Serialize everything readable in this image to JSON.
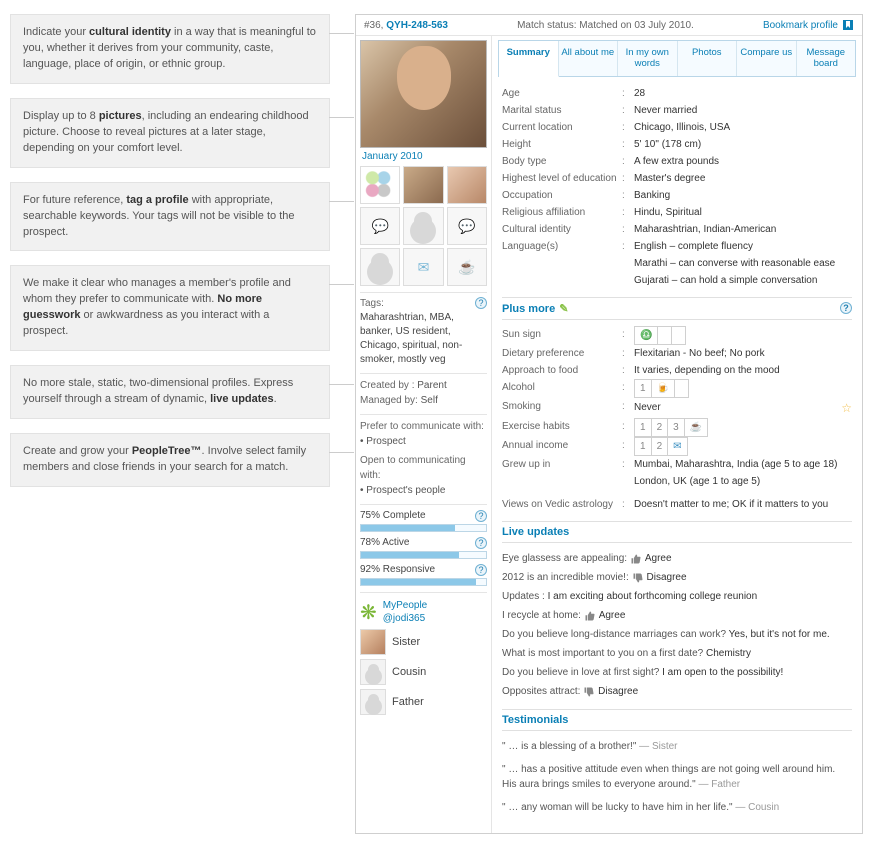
{
  "callouts": [
    "Indicate your <b>cultural identity</b> in a way that is meaningful to you, whether it derives from your community, caste, language, place of origin, or ethnic group.",
    "Display up to 8 <b>pictures</b>, including an endearing childhood picture.  Choose to reveal pictures at a later stage, depending on your comfort level.",
    "For future reference, <b>tag a profile</b> with appropriate, searchable keywords. Your tags will not be visible to the prospect.",
    "We make it clear who manages a member's profile and whom they prefer to communicate with. <b>No more guesswork</b> or awkwardness as you interact with a prospect.",
    "No more stale, static, two-dimensional profiles. Express yourself through a stream of dynamic, <b>live updates</b>.",
    "Create and grow your <b>PeopleTree™</b>. Involve select family members and close friends in your search for a match."
  ],
  "topbar": {
    "num": "#36,",
    "code": "QYH-248-563",
    "match_status": "Match status: Matched on 03 July 2010.",
    "bookmark": "Bookmark profile"
  },
  "photo_caption": "January 2010",
  "tags_label": "Tags:",
  "tags_text": "Maharashtrian, MBA, banker, US resident, Chicago, spiritual, non-smoker, mostly veg",
  "mgmt": {
    "created_lbl": "Created by  :",
    "created_val": "Parent",
    "managed_lbl": "Managed by:",
    "managed_val": "Self",
    "prefer_lbl": "Prefer to communicate with:",
    "prefer_val": "Prospect",
    "open_lbl": "Open to communicating with:",
    "open_val": "Prospect's people"
  },
  "meters": [
    {
      "label": "75% Complete",
      "pct": 75
    },
    {
      "label": "78% Active",
      "pct": 78
    },
    {
      "label": "92% Responsive",
      "pct": 92
    }
  ],
  "mypeople": {
    "title": "MyPeople",
    "handle": "@jodi365"
  },
  "relatives": [
    "Sister",
    "Cousin",
    "Father"
  ],
  "tabs": [
    "Summary",
    "All about me",
    "In my own words",
    "Photos",
    "Compare us",
    "Message board"
  ],
  "summary": [
    {
      "k": "Age",
      "v": "28"
    },
    {
      "k": "Marital status",
      "v": "Never married"
    },
    {
      "k": "Current location",
      "v": "Chicago, Illinois, USA"
    },
    {
      "k": "Height",
      "v": "5' 10\" (178 cm)"
    },
    {
      "k": "Body type",
      "v": "A few extra pounds"
    },
    {
      "k": "Highest level of education",
      "v": "Master's degree"
    },
    {
      "k": "Occupation",
      "v": "Banking"
    },
    {
      "k": "Religious affiliation",
      "v": "Hindu, Spiritual"
    },
    {
      "k": "Cultural identity",
      "v": "Maharashtrian, Indian-American"
    },
    {
      "k": "Language(s)",
      "v": "English – complete fluency"
    }
  ],
  "languages_extra": [
    "Marathi – can converse with reasonable ease",
    "Gujarati – can hold a simple conversation"
  ],
  "plusmore_hdr": "Plus more",
  "plusmore": {
    "sunsign_k": "Sun sign",
    "diet_k": "Dietary preference",
    "diet_v": "Flexitarian - No beef; No pork",
    "approach_k": "Approach to food",
    "approach_v": "It varies, depending on the mood",
    "alcohol_k": "Alcohol",
    "smoking_k": "Smoking",
    "smoking_v": "Never",
    "exercise_k": "Exercise habits",
    "income_k": "Annual income",
    "grew_k": "Grew up in",
    "grew_v": "Mumbai, Maharashtra, India (age 5 to age 18)",
    "grew_v2": "London, UK (age 1 to age 5)",
    "vedic_k": "Views on Vedic astrology",
    "vedic_v": "Doesn't matter to me; OK if it matters to you"
  },
  "liveupdates_hdr": "Live updates",
  "liveupdates": [
    {
      "q": "Eye glassess are appealing:",
      "icon": "up",
      "a": "Agree"
    },
    {
      "q": "2012 is an incredible movie!:",
      "icon": "down",
      "a": "Disagree"
    },
    {
      "q": "Updates :",
      "icon": "",
      "a": "I am exciting about forthcoming college reunion"
    },
    {
      "q": "I recycle at home:",
      "icon": "up",
      "a": "Agree"
    },
    {
      "q": "Do you believe long-distance marriages can work?",
      "icon": "",
      "a": "Yes, but it's not for me."
    },
    {
      "q": "What is most important to you on a first date?",
      "icon": "",
      "a": "Chemistry"
    },
    {
      "q": "Do you believe in love at first sight?",
      "icon": "",
      "a": "I am open to the possibility!"
    },
    {
      "q": "Opposites attract:",
      "icon": "down",
      "a": "Disagree"
    }
  ],
  "testimonials_hdr": "Testimonials",
  "testimonials": [
    {
      "text": "\" … is a blessing of a brother!\"",
      "who": "— Sister"
    },
    {
      "text": "\" … has a positive attitude even when things are not going well around him. His aura brings smiles to everyone around.\"",
      "who": "— Father"
    },
    {
      "text": "\" … any woman will be lucky to have him in her life.\"",
      "who": "— Cousin"
    }
  ]
}
